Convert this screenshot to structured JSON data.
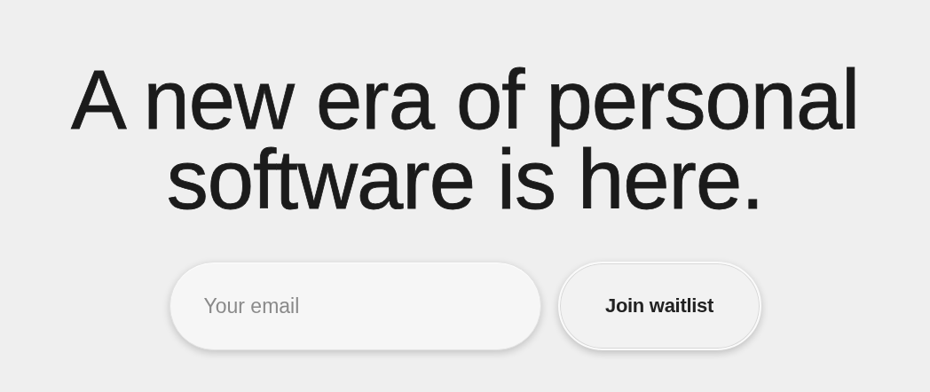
{
  "headline": [
    "A new era of personal",
    "software is here."
  ],
  "signup": {
    "email": {
      "placeholder": "Your email"
    },
    "button": "Join waitlist"
  }
}
